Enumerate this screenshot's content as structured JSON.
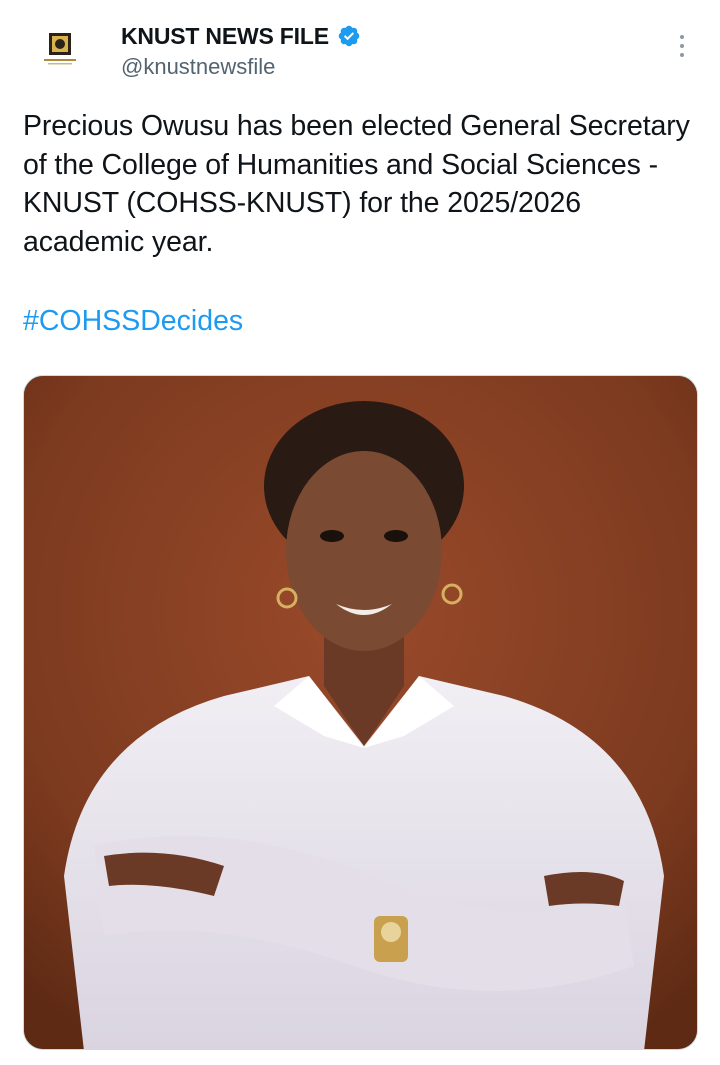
{
  "author": {
    "display_name": "KNUST NEWS FILE",
    "handle": "@knustnewsfile",
    "verified": true
  },
  "tweet": {
    "text": "Precious Owusu has been elected General Secretary of the College of Humanities and Social Sciences -KNUST (COHSS-KNUST) for the 2025/2026 academic year.",
    "hashtag": "#COHSSDecides"
  },
  "media": {
    "kind": "portrait photo",
    "background_color": "#8a3e22"
  },
  "colors": {
    "link": "#1d9bf0",
    "verified_badge": "#1d9bf0",
    "secondary_text": "#536471"
  },
  "icons": {
    "verified": "verified-badge-icon",
    "more": "more-options-icon"
  }
}
